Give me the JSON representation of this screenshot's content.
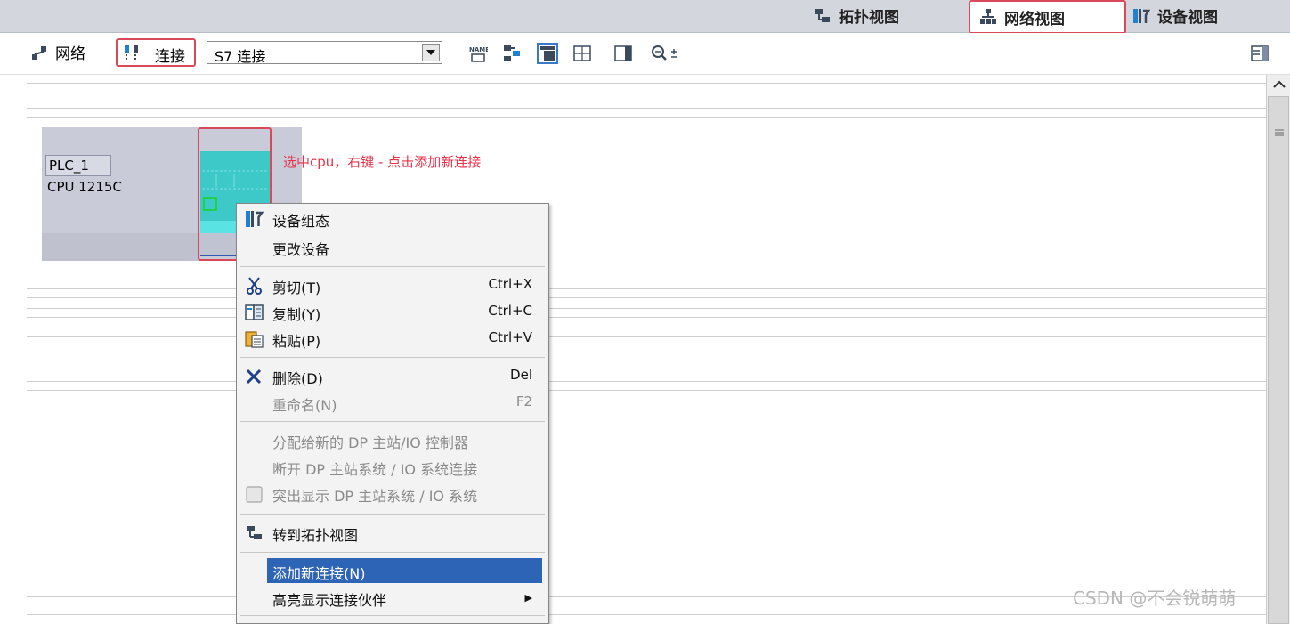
{
  "view_tabs": [
    {
      "label": "拓扑视图"
    },
    {
      "label": "网络视图"
    },
    {
      "label": "设备视图"
    }
  ],
  "toolbar": {
    "network_label": "网络",
    "connections_label": "连接",
    "connection_type_value": "S7 连接"
  },
  "device": {
    "name": "PLC_1",
    "type": "CPU 1215C"
  },
  "annotation": "选中cpu，右键 - 点击添加新连接",
  "context_menu": [
    {
      "label": "设备组态",
      "shortcut": ""
    },
    {
      "label": "更改设备",
      "shortcut": ""
    },
    {
      "label": "剪切(T)",
      "shortcut": "Ctrl+X"
    },
    {
      "label": "复制(Y)",
      "shortcut": "Ctrl+C"
    },
    {
      "label": "粘贴(P)",
      "shortcut": "Ctrl+V"
    },
    {
      "label": "删除(D)",
      "shortcut": "Del"
    },
    {
      "label": "重命名(N)",
      "shortcut": "F2"
    },
    {
      "label": "分配给新的 DP 主站/IO 控制器",
      "shortcut": ""
    },
    {
      "label": "断开 DP 主站系统 / IO 系统连接",
      "shortcut": ""
    },
    {
      "label": "突出显示 DP 主站系统 / IO 系统",
      "shortcut": ""
    },
    {
      "label": "转到拓扑视图",
      "shortcut": ""
    },
    {
      "label": "添加新连接(N)",
      "shortcut": ""
    },
    {
      "label": "高亮显示连接伙伴",
      "shortcut": "▶"
    }
  ],
  "watermark": "CSDN @不会锐萌萌",
  "colors": {
    "highlight": "#2e64b6",
    "annotation": "#e8334a",
    "accent_box": "#d84a5a",
    "cpu": "#3ec9c9"
  }
}
